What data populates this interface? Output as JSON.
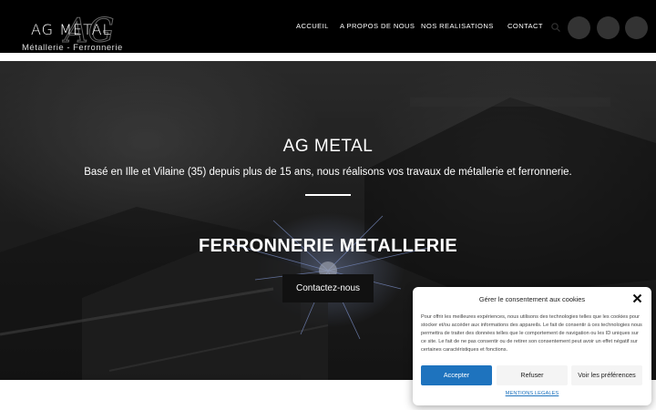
{
  "header": {
    "logo": {
      "mark_text": "AG",
      "title": "AG METAL",
      "subtitle": "Métallerie - Ferronnerie"
    },
    "nav": [
      {
        "label": "ACCUEIL"
      },
      {
        "label": "A PROPOS DE NOUS"
      },
      {
        "label": "NOS REALISATIONS"
      },
      {
        "label": "CONTACT"
      }
    ],
    "search_icon": "search-icon",
    "social_icons": [
      "social-icon-1",
      "social-icon-2",
      "social-icon-3"
    ]
  },
  "hero": {
    "title": "AG METAL",
    "subtitle": "Basé en Ille et Vilaine (35) depuis plus de 15 ans, nous réalisons vos travaux de métallerie et ferronnerie.",
    "heading": "FERRONNERIE METALLERIE",
    "cta_label": "Contactez-nous"
  },
  "cookie_banner": {
    "title": "Gérer le consentement aux cookies",
    "body": "Pour offrir les meilleures expériences, nous utilisons des technologies telles que les cookies pour stocker et/ou accéder aux informations des appareils. Le fait de consentir à ces technologies nous permettra de traiter des données telles que le comportement de navigation ou les ID uniques sur ce site. Le fait de ne pas consentir ou de retirer son consentement peut avoir un effet négatif sur certaines caractéristiques et fonctions.",
    "accept_label": "Accepter",
    "refuse_label": "Refuser",
    "prefs_label": "Voir les préférences",
    "legal_link": "MENTIONS LEGALES"
  },
  "colors": {
    "header_bg": "#000000",
    "accent_blue": "#1e73be",
    "cta_bg": "#111111"
  }
}
